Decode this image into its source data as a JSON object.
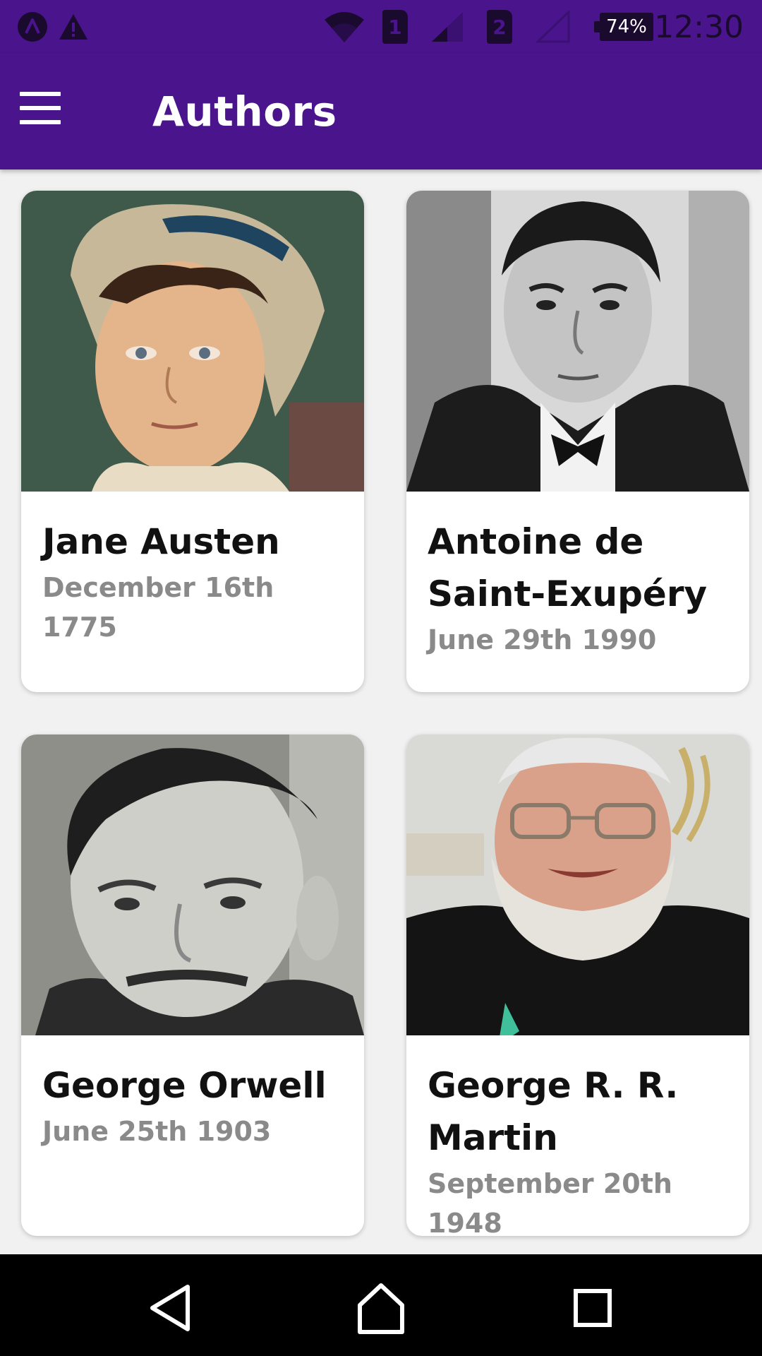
{
  "status_bar": {
    "time": "12:30",
    "battery": "74%",
    "sim1": "1",
    "sim2": "2",
    "icons": [
      "app-logo-icon",
      "warning-icon",
      "wifi-icon",
      "sim1-icon",
      "signal-icon",
      "sim2-icon",
      "signal-empty-icon",
      "battery-icon"
    ]
  },
  "app_bar": {
    "title": "Authors",
    "menu_icon": "hamburger-menu-icon"
  },
  "authors": [
    {
      "name": "Jane Austen",
      "date": "December 16th 1775"
    },
    {
      "name": "Antoine de Saint-Exupéry",
      "date": "June 29th 1990"
    },
    {
      "name": "George Orwell",
      "date": "June 25th 1903"
    },
    {
      "name": "George R. R. Martin",
      "date": "September 20th 1948"
    }
  ],
  "nav_bar": {
    "icons": [
      "back-icon",
      "home-icon",
      "recents-icon"
    ]
  },
  "colors": {
    "primary": "#4a148c",
    "background": "#f1f1f1",
    "card": "#ffffff",
    "title_text": "#111111",
    "date_text": "#8a8a8a"
  }
}
